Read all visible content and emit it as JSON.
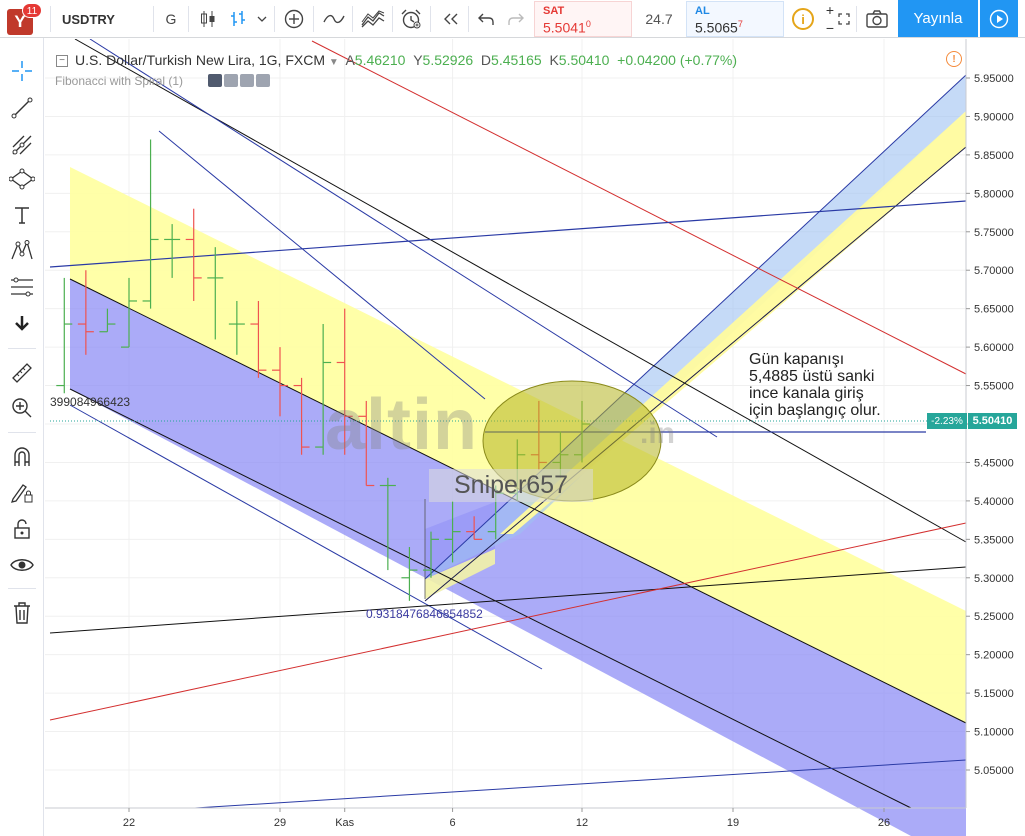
{
  "toolbar": {
    "notification_count": "11",
    "symbol": "USDTRY",
    "interval": "G",
    "sell_label": "SAT",
    "sell_price_main": "5.50",
    "sell_price_big": "41",
    "sell_price_sup": "0",
    "spread": "24.7",
    "buy_label": "AL",
    "buy_price_main": "5.50",
    "buy_price_big": "65",
    "buy_price_sup": "7",
    "publish_label": "Yayınla"
  },
  "sidebar": {
    "items": [
      "crosshair-icon",
      "trend-line-icon",
      "pitchfork-icon",
      "shapes-icon",
      "text-icon",
      "pattern-icon",
      "fib-tools-icon",
      "arrow-down-icon",
      "ruler-icon",
      "zoom-in-icon",
      "magnet-icon",
      "lock-drawing-icon",
      "unlock-icon",
      "eye-icon",
      "trash-icon"
    ]
  },
  "legend": {
    "title": "U.S. Dollar/Turkish New Lira, 1G, FXCM",
    "open_label": "A",
    "open": "5.46210",
    "high_label": "Y",
    "high": "5.52926",
    "low_label": "D",
    "low": "5.45165",
    "close_label": "K",
    "close": "5.50410",
    "change": "+0.04200 (+0.77%)",
    "fib_label": "Fibonacci with Spiral (1)"
  },
  "annotations": {
    "note_lines": [
      "Gün kapanışı",
      "5,4885 üstü sanki",
      "ince kanala giriş",
      "için başlangıç olur."
    ],
    "left_value": "399084966423",
    "mid_value": "0.9318476846854852",
    "watermark": "altin",
    "watermark_suffix": ".in",
    "author": "Sniper657"
  },
  "price_tag": {
    "change": "-2.23%",
    "price": "5.50410"
  },
  "colors": {
    "accent": "#2196f3",
    "up": "#4caf50",
    "down": "#ef5350",
    "channel_blue": "#8f8ff5",
    "channel_yellow": "#ffff9e"
  },
  "chart_data": {
    "type": "ohlc",
    "title": "U.S. Dollar/Turkish New Lira, 1G, FXCM",
    "ylim": [
      5.0,
      5.97
    ],
    "y_ticks": [
      "5.95000",
      "5.90000",
      "5.85000",
      "5.80000",
      "5.75000",
      "5.70000",
      "5.65000",
      "5.60000",
      "5.55000",
      "5.50000",
      "5.45000",
      "5.40000",
      "5.35000",
      "5.30000",
      "5.25000",
      "5.20000",
      "5.15000",
      "5.10000",
      "5.05000"
    ],
    "y_tick_values": [
      5.95,
      5.9,
      5.85,
      5.8,
      5.75,
      5.7,
      5.65,
      5.6,
      5.55,
      5.5,
      5.45,
      5.4,
      5.35,
      5.3,
      5.25,
      5.2,
      5.15,
      5.1,
      5.05
    ],
    "x_ticks": [
      "22",
      "29",
      "Kas",
      "6",
      "12",
      "19",
      "26"
    ],
    "x_tick_days": [
      22,
      29,
      32,
      37,
      43,
      50,
      57
    ],
    "xlim": [
      18.7,
      62
    ],
    "bars": [
      {
        "d": 19,
        "o": 5.55,
        "h": 5.69,
        "l": 5.54,
        "c": 5.63
      },
      {
        "d": 20,
        "o": 5.63,
        "h": 5.7,
        "l": 5.59,
        "c": 5.62
      },
      {
        "d": 21,
        "o": 5.62,
        "h": 5.65,
        "l": 5.62,
        "c": 5.63
      },
      {
        "d": 22,
        "o": 5.6,
        "h": 5.69,
        "l": 5.6,
        "c": 5.66
      },
      {
        "d": 23,
        "o": 5.66,
        "h": 5.87,
        "l": 5.65,
        "c": 5.74
      },
      {
        "d": 24,
        "o": 5.74,
        "h": 5.76,
        "l": 5.69,
        "c": 5.74
      },
      {
        "d": 25,
        "o": 5.74,
        "h": 5.78,
        "l": 5.66,
        "c": 5.69
      },
      {
        "d": 26,
        "o": 5.69,
        "h": 5.73,
        "l": 5.61,
        "c": 5.69
      },
      {
        "d": 27,
        "o": 5.63,
        "h": 5.66,
        "l": 5.59,
        "c": 5.63
      },
      {
        "d": 28,
        "o": 5.63,
        "h": 5.66,
        "l": 5.56,
        "c": 5.57
      },
      {
        "d": 29,
        "o": 5.57,
        "h": 5.6,
        "l": 5.51,
        "c": 5.55
      },
      {
        "d": 30,
        "o": 5.55,
        "h": 5.56,
        "l": 5.46,
        "c": 5.47
      },
      {
        "d": 31,
        "o": 5.47,
        "h": 5.63,
        "l": 5.46,
        "c": 5.58
      },
      {
        "d": 32,
        "o": 5.58,
        "h": 5.65,
        "l": 5.46,
        "c": 5.51
      },
      {
        "d": 33,
        "o": 5.51,
        "h": 5.53,
        "l": 5.42,
        "c": 5.42
      },
      {
        "d": 34,
        "o": 5.42,
        "h": 5.43,
        "l": 5.31,
        "c": 5.42
      },
      {
        "d": 35,
        "o": 5.3,
        "h": 5.34,
        "l": 5.27,
        "c": 5.31
      },
      {
        "d": 36,
        "o": 5.31,
        "h": 5.36,
        "l": 5.3,
        "c": 5.35
      },
      {
        "d": 37,
        "o": 5.35,
        "h": 5.4,
        "l": 5.32,
        "c": 5.36
      },
      {
        "d": 38,
        "o": 5.36,
        "h": 5.38,
        "l": 5.35,
        "c": 5.35
      },
      {
        "d": 39,
        "o": 5.36,
        "h": 5.42,
        "l": 5.35,
        "c": 5.41
      },
      {
        "d": 40,
        "o": 5.41,
        "h": 5.48,
        "l": 5.4,
        "c": 5.46
      },
      {
        "d": 41,
        "o": 5.46,
        "h": 5.53,
        "l": 5.44,
        "c": 5.45
      },
      {
        "d": 42,
        "o": 5.45,
        "h": 5.49,
        "l": 5.43,
        "c": 5.46
      },
      {
        "d": 43,
        "o": 5.46,
        "h": 5.53,
        "l": 5.45,
        "c": 5.5
      }
    ]
  }
}
